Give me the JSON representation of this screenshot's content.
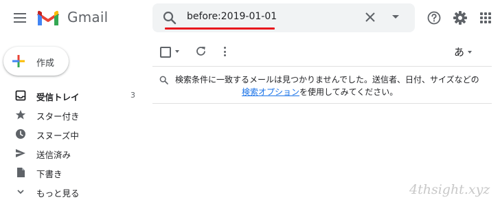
{
  "app": {
    "name": "Gmail"
  },
  "search": {
    "query": "before:2019-01-01"
  },
  "compose": {
    "label": "作成"
  },
  "sidebar": {
    "items": [
      {
        "label": "受信トレイ",
        "count": "3",
        "icon": "inbox-icon",
        "bold": true
      },
      {
        "label": "スター付き",
        "icon": "star-icon"
      },
      {
        "label": "スヌーズ中",
        "icon": "clock-icon"
      },
      {
        "label": "送信済み",
        "icon": "send-icon"
      },
      {
        "label": "下書き",
        "icon": "draft-icon"
      },
      {
        "label": "もっと見る",
        "icon": "chevron-down-icon"
      }
    ]
  },
  "toolbar": {
    "input_tools": "あ"
  },
  "results": {
    "empty_line1": "検索条件に一致するメールは見つかりませんでした。送信者、日付、サイズなどの",
    "empty_link": "検索オプション",
    "empty_line2_rest": "を使用してみてください。"
  },
  "watermark": "4thsight.xyz",
  "colors": {
    "accent_red": "#e8151c",
    "link_blue": "#1a73e8",
    "search_bg": "#f1f3f4",
    "icon_gray": "#5f6368"
  }
}
